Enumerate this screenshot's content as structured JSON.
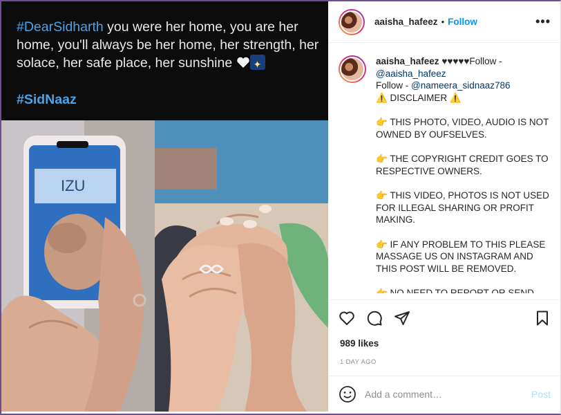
{
  "media": {
    "hashtag1": "#DearSidharth",
    "caption": " you were her home, you are her home, you'll always be her home, her strength, her solace, her safe place, her sunshine ",
    "hashtag2": "#SidNaaz"
  },
  "header": {
    "username": "aaisha_hafeez",
    "separator": "•",
    "follow_label": "Follow",
    "more_label": "•••"
  },
  "post": {
    "username": "aaisha_hafeez",
    "line1_suffix": " ♥♥♥♥♥Follow -",
    "handle1": "@aaisha_hafeez",
    "line3_prefix": "Follow - ",
    "handle2": "@nameera_sidnaaz786",
    "disclaimer": "⚠️ DISCLAIMER ⚠️",
    "points": [
      "👉 THIS PHOTO, VIDEO, AUDIO IS NOT OWNED BY OUFSELVES.",
      "👉 THE COPYRIGHT CREDIT GOES TO RESPECTIVE OWNERS.",
      "👉 THIS VIDEO, PHOTOS IS NOT USED FOR ILLEGAL SHARING OR PROFIT MAKING.",
      "👉 IF ANY PROBLEM TO THIS PLEASE MASSAGE US ON INSTAGRAM AND THIS POST WILL BE REMOVED."
    ],
    "cut_line": "👉 NO NEED TO REPORT OR SEND"
  },
  "stats": {
    "likes": "989 likes",
    "date": "1 DAY AGO"
  },
  "comment_box": {
    "placeholder": "Add a comment…",
    "post_label": "Post"
  },
  "icons": {
    "like": "heart-icon",
    "comment": "comment-icon",
    "share": "share-icon",
    "save": "bookmark-icon",
    "emoji": "smile-icon"
  }
}
